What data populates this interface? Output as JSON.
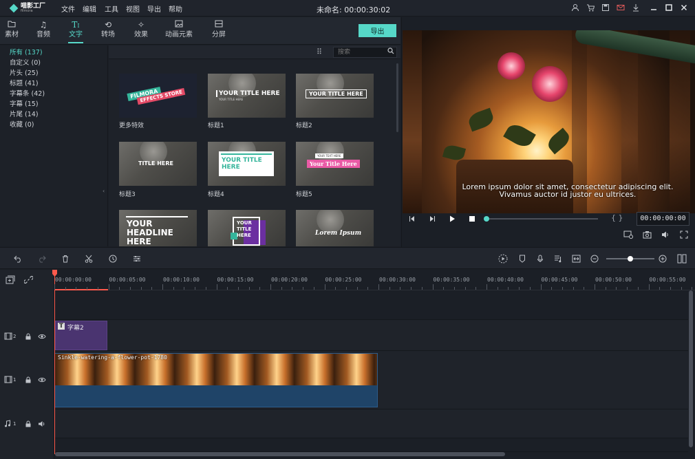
{
  "app": {
    "logo_text": "喵影工厂",
    "logo_sub": "filmora",
    "menu": [
      "文件",
      "编辑",
      "工具",
      "视图",
      "导出",
      "帮助"
    ],
    "document_title": "未命名: 00:00:30:02"
  },
  "titlebar_icons": [
    "user-icon",
    "cart-icon",
    "save-icon",
    "mail-icon",
    "download-icon",
    "minimize-icon",
    "maximize-icon",
    "close-icon"
  ],
  "tabs": [
    {
      "label": "素材",
      "icon": "folder-icon",
      "active": false
    },
    {
      "label": "音频",
      "icon": "music-note-icon",
      "active": false
    },
    {
      "label": "文字",
      "icon": "text-icon",
      "active": true
    },
    {
      "label": "转场",
      "icon": "transition-icon",
      "active": false
    },
    {
      "label": "效果",
      "icon": "effects-icon",
      "active": false
    },
    {
      "label": "动画元素",
      "icon": "image-icon",
      "active": false
    },
    {
      "label": "分屏",
      "icon": "split-screen-icon",
      "active": false
    }
  ],
  "export_label": "导出",
  "categories": [
    {
      "label": "所有 (137)",
      "active": true
    },
    {
      "label": "自定义 (0)",
      "active": false
    },
    {
      "label": "片头 (25)",
      "active": false
    },
    {
      "label": "标题 (41)",
      "active": false
    },
    {
      "label": "字幕条 (42)",
      "active": false
    },
    {
      "label": "字幕 (15)",
      "active": false
    },
    {
      "label": "片尾 (14)",
      "active": false
    },
    {
      "label": "收藏 (0)",
      "active": false
    }
  ],
  "search": {
    "placeholder": "搜索"
  },
  "thumbnails": [
    {
      "label": "更多特效",
      "overlay_lines": [
        "FILMORA",
        "EFFECTS STORE"
      ]
    },
    {
      "label": "标题1",
      "overlay_lines": [
        "YOUR TITLE HERE",
        "YOUR TITLE HERE"
      ]
    },
    {
      "label": "标题2",
      "overlay_lines": [
        "YOUR TITLE HERE"
      ]
    },
    {
      "label": "标题3",
      "overlay_lines": [
        "TITLE HERE"
      ]
    },
    {
      "label": "标题4",
      "overlay_lines": [
        "YOUR TITLE",
        "HERE"
      ]
    },
    {
      "label": "标题5",
      "overlay_lines": [
        "YOUR TEXT HERE",
        "Your Title Here"
      ]
    },
    {
      "label": "",
      "overlay_lines": [
        "YOUR",
        "HEADLINE",
        "HERE"
      ]
    },
    {
      "label": "",
      "overlay_lines": [
        "YOUR",
        "TITLE",
        "HERE"
      ]
    },
    {
      "label": "",
      "overlay_lines": [
        "Lorem Ipsum"
      ]
    }
  ],
  "preview": {
    "caption_line1": "Lorem ipsum dolor sit amet, consectetur adipiscing elit.",
    "caption_line2": "Vivamus auctor id justor eu ultrices.",
    "timecode": "00:00:00:00",
    "progress_fraction": 0.0,
    "bracket_label": "{ }"
  },
  "timeline": {
    "ruler_labels": [
      "00:00:00:00",
      "00:00:05:00",
      "00:00:10:00",
      "00:00:15:00",
      "00:00:20:00",
      "00:00:25:00",
      "00:00:30:00",
      "00:00:35:00",
      "00:00:40:00",
      "00:00:45:00",
      "00:00:50:00",
      "00:00:55:00"
    ],
    "tracks": [
      {
        "type": "video",
        "number": "2"
      },
      {
        "type": "video",
        "number": "1"
      },
      {
        "type": "audio",
        "number": "1"
      }
    ],
    "title_clip": {
      "icon_letter": "T",
      "label": "字幕2"
    },
    "video_clip": {
      "label": "Sinkle-watering-a-flower-pot-1780"
    },
    "zoom_fraction": 0.5
  },
  "colors": {
    "accent": "#56d8c8",
    "playhead": "#ff5a4c",
    "title_clip": "#4a3470",
    "video_clip": "#1f4468"
  }
}
